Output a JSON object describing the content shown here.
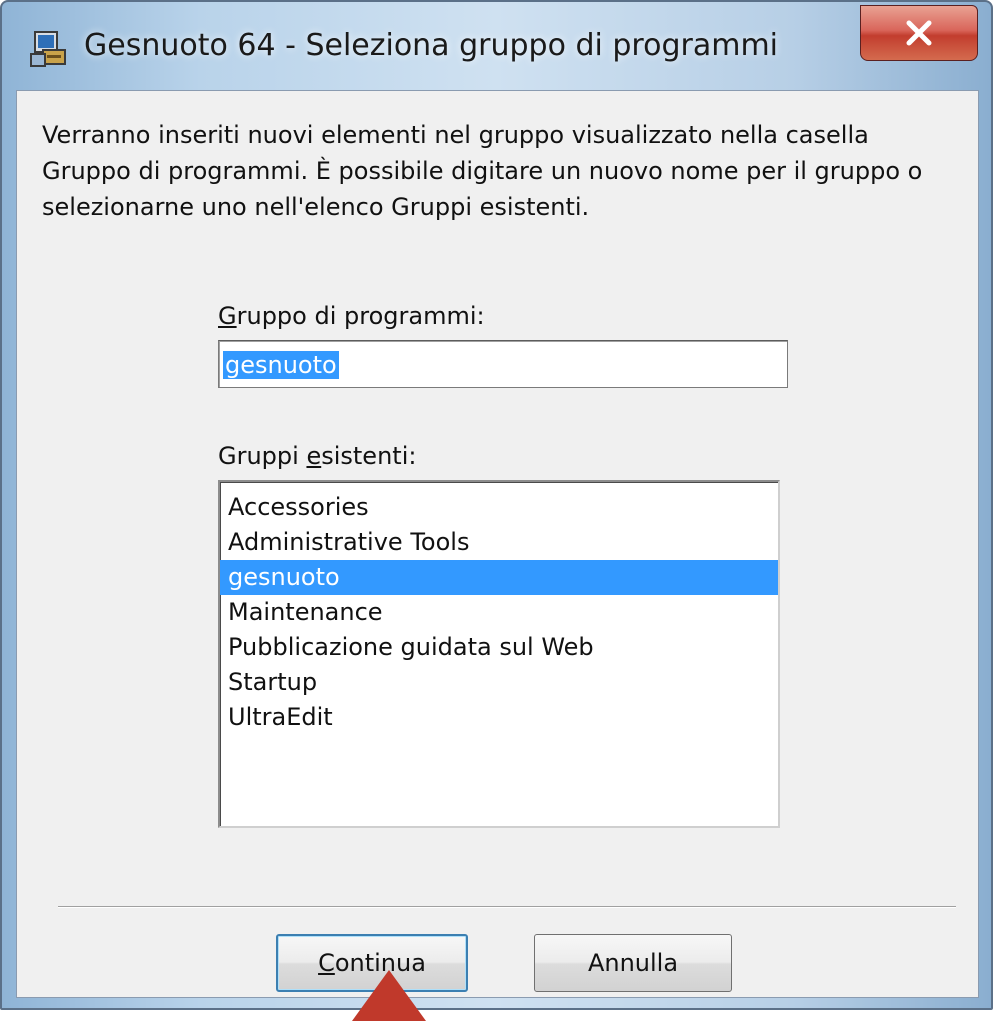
{
  "window": {
    "title": "Gesnuoto 64 - Seleziona gruppo di programmi",
    "app_icon": "setup-program-icon",
    "close_icon": "close-icon"
  },
  "intro_text": "Verranno inseriti nuovi elementi nel gruppo visualizzato nella casella Gruppo di programmi. È possibile digitare un nuovo nome per il gruppo o selezionarne uno nell'elenco Gruppi esistenti.",
  "program_group": {
    "label": "Gruppo di programmi:",
    "value": "gesnuoto"
  },
  "existing_groups": {
    "label": "Gruppi esistenti:",
    "items": [
      "Accessories",
      "Administrative Tools",
      "gesnuoto",
      "Maintenance",
      "Pubblicazione guidata sul Web",
      "Startup",
      "UltraEdit"
    ],
    "selected_index": 2
  },
  "buttons": {
    "continue": "Continua",
    "cancel": "Annulla"
  },
  "colors": {
    "selection": "#3399ff",
    "close_button": "#c94a3b",
    "marker": "#c0392b"
  }
}
